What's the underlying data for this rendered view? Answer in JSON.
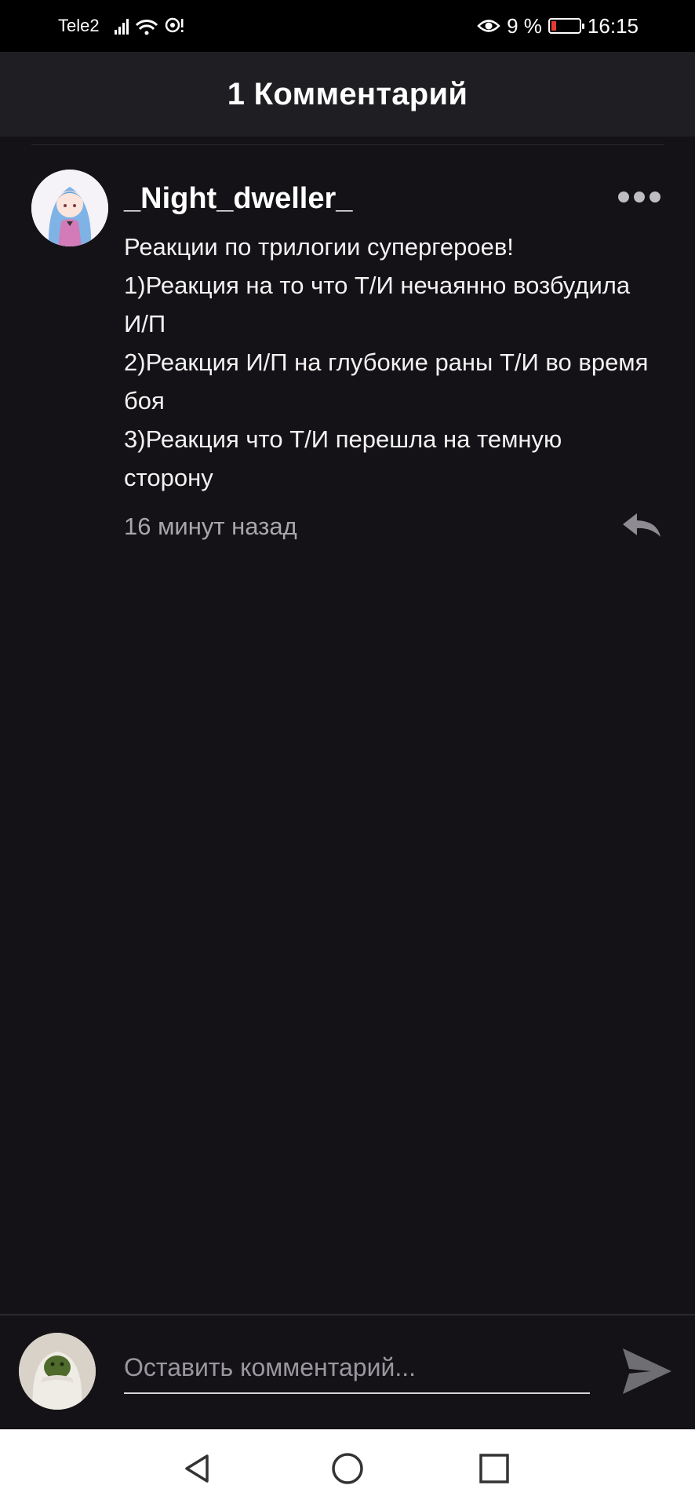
{
  "status_bar": {
    "carrier": "Tele2",
    "battery_percent": "9 %",
    "time": "16:15"
  },
  "header": {
    "title": "1 Комментарий"
  },
  "comment": {
    "username": "_Night_dweller_",
    "text": "Реакции по трилогии супергероев!\n1)Реакция на то что Т/И нечаянно возбудила И/П\n2)Реакция И/П на глубокие раны Т/И во время боя\n3)Реакция что Т/И перешла на темную сторону",
    "timestamp": "16 минут назад"
  },
  "composer": {
    "placeholder": "Оставить комментарий..."
  },
  "colors": {
    "background": "#141216",
    "header": "#1f1e22",
    "secondary_text": "#a8a6ab",
    "battery_low": "#e53935"
  },
  "icons": [
    "signal-icon",
    "wifi-icon",
    "hotspot-icon",
    "eye-comfort-icon",
    "battery-icon",
    "more-icon",
    "reply-icon",
    "send-icon",
    "back-nav-icon",
    "home-nav-icon",
    "recents-nav-icon"
  ]
}
